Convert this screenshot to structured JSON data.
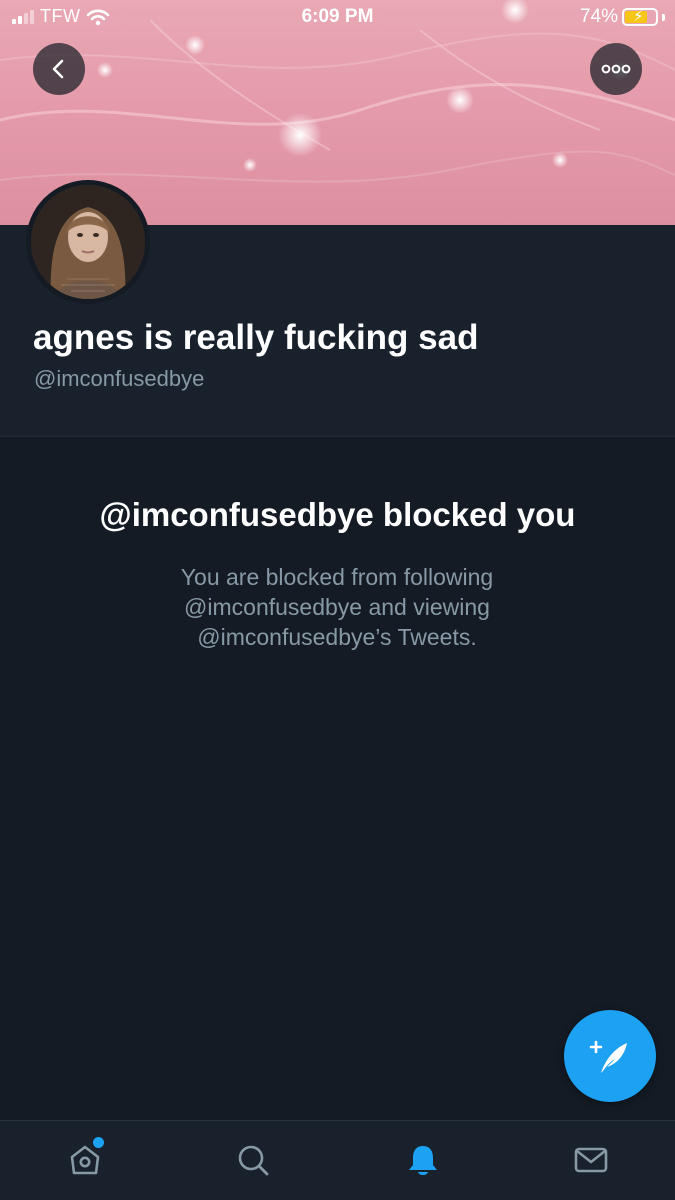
{
  "status_bar": {
    "carrier": "TFW",
    "time": "6:09 PM",
    "battery": "74%",
    "battery_level": 0.74,
    "icons": [
      "signal-icon",
      "wifi-icon",
      "battery-charging-icon"
    ]
  },
  "header": {
    "back_icon": "chevron-left-icon",
    "more_icon": "more-horizontal-icon"
  },
  "profile": {
    "display_name": "agnes is really fucking sad",
    "handle": "@imconfusedbye"
  },
  "blocked": {
    "title": "@imconfusedbye blocked you",
    "line1": "You are blocked from following",
    "line2": "@imconfusedbye and viewing",
    "line3": "@imconfusedbye’s Tweets."
  },
  "fab": {
    "icon": "compose-tweet-icon"
  },
  "tab_bar": {
    "items": [
      {
        "icon": "home-icon",
        "active": false,
        "has_badge": true
      },
      {
        "icon": "search-icon",
        "active": false
      },
      {
        "icon": "bell-icon",
        "active": true
      },
      {
        "icon": "mail-icon",
        "active": false
      }
    ]
  },
  "colors": {
    "accent": "#1da1f2",
    "background": "#141b24",
    "header_bg": "#18212c",
    "secondary_text": "#8899a6"
  }
}
